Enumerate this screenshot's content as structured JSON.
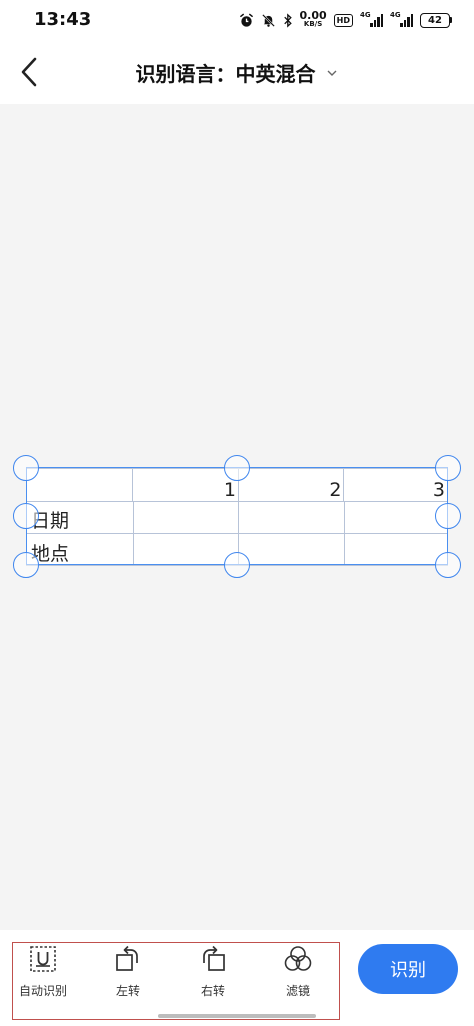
{
  "status": {
    "time": "13:43",
    "net_speed_value": "0.00",
    "net_speed_unit": "KB/S",
    "hd_label": "HD",
    "sig1_label": "4G",
    "sig2_label": "4G",
    "battery": "42"
  },
  "header": {
    "title_prefix": "识别语言：",
    "language": "中英混合"
  },
  "table": {
    "header_cells": [
      "",
      "1",
      "2",
      "3"
    ],
    "rows": [
      [
        "日期",
        "",
        "",
        ""
      ],
      [
        "地点",
        "",
        "",
        ""
      ]
    ]
  },
  "toolbar": {
    "items": [
      {
        "label": "自动识别",
        "icon": "auto-detect-icon"
      },
      {
        "label": "左转",
        "icon": "rotate-left-icon"
      },
      {
        "label": "右转",
        "icon": "rotate-right-icon"
      },
      {
        "label": "滤镜",
        "icon": "filter-icon"
      }
    ],
    "recognize_label": "识别"
  },
  "colors": {
    "accent": "#2f7bf0",
    "crop_frame": "#3f86ee",
    "highlight_box": "#c0504d",
    "canvas_bg": "#f4f4f4"
  }
}
